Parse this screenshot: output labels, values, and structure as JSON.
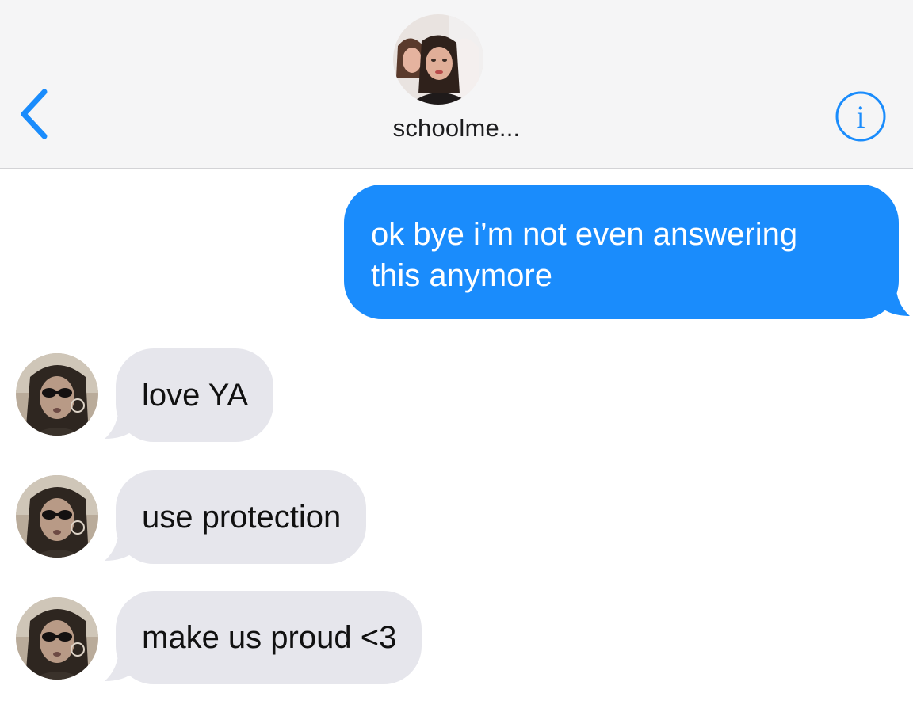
{
  "header": {
    "contact_name": "schoolme...",
    "back_icon": "chevron-left-icon",
    "info_icon": "info-icon",
    "accent_color": "#1a8cfc"
  },
  "messages": [
    {
      "direction": "sent",
      "text_line1": "ok bye i’m not even answering",
      "text_line2": "this anymore"
    },
    {
      "direction": "received",
      "text": "love YA"
    },
    {
      "direction": "received",
      "text": "use protection"
    },
    {
      "direction": "received",
      "text": "make us proud <3"
    }
  ],
  "colors": {
    "sent_bubble": "#1a8cfc",
    "received_bubble": "#e6e6ec",
    "header_bg": "#f5f5f6"
  }
}
